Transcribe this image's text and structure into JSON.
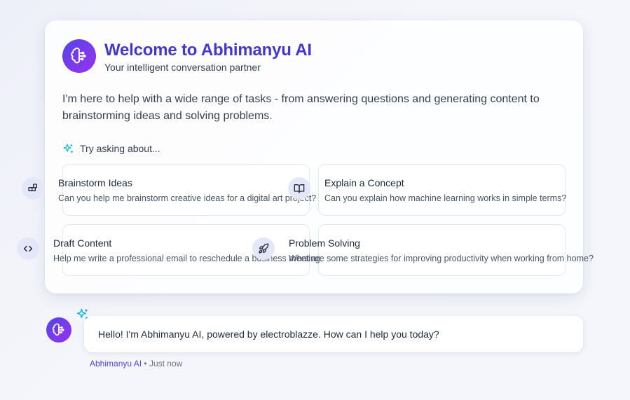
{
  "welcome": {
    "title": "Welcome to Abhimanyu AI",
    "subtitle": "Your intelligent conversation partner",
    "intro": "I'm here to help with a wide range of tasks - from answering questions and generating content to brainstorming ideas and solving problems.",
    "try_label": "Try asking about..."
  },
  "prompts": [
    {
      "title": "Brainstorm Ideas",
      "description": "Can you help me brainstorm creative ideas for a digital art project?",
      "icon": "grid-plus-icon"
    },
    {
      "title": "Explain a Concept",
      "description": "Can you explain how machine learning works in simple terms?",
      "icon": "book-open-icon"
    },
    {
      "title": "Draft Content",
      "description": "Help me write a professional email to reschedule a business meeting.",
      "icon": "code-icon"
    },
    {
      "title": "Problem Solving",
      "description": "What are some strategies for improving productivity when working from home?",
      "icon": "rocket-icon"
    }
  ],
  "message": {
    "text": "Hello! I'm Abhimanyu AI, powered by electroblazze. How can I help you today?",
    "author": "Abhimanyu AI",
    "separator": "•",
    "time": "Just now"
  },
  "colors": {
    "accent": "#4338ca",
    "logo_gradient_start": "#4f46e5",
    "logo_gradient_end": "#9333ea",
    "sparkle": "#06b6d4",
    "icon_bg": "#e4e7f7"
  }
}
